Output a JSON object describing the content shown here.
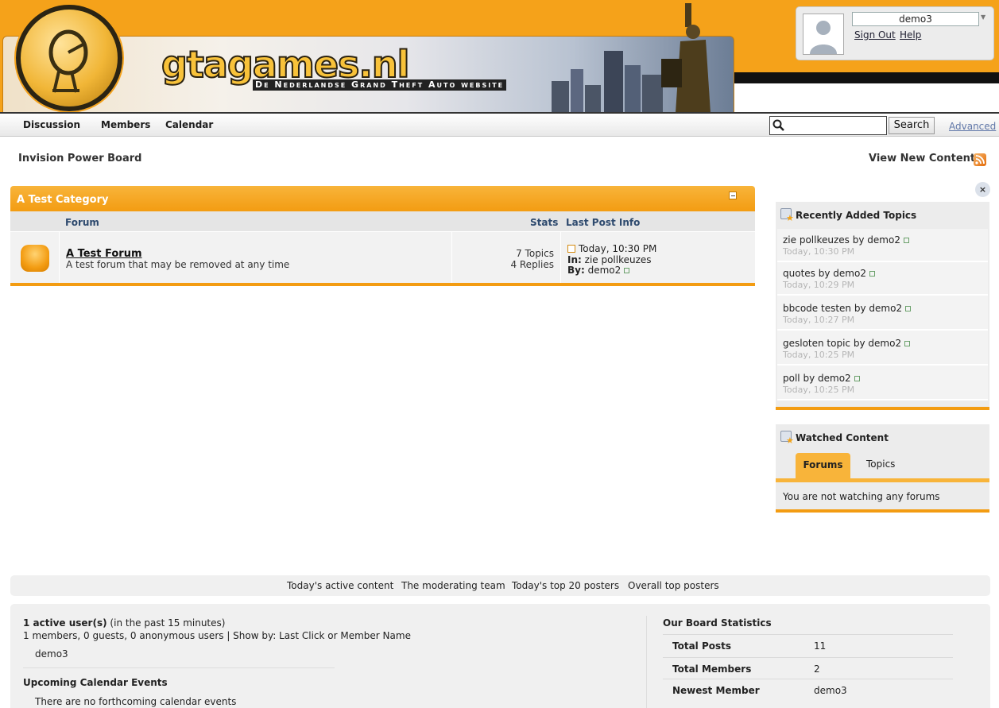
{
  "header": {
    "site_name": "gtagames.nl",
    "tagline": "De Nederlandse Grand Theft Auto website",
    "brand_color": "#f5a21a"
  },
  "user_panel": {
    "username": "demo3",
    "sign_out": "Sign Out",
    "help": "Help"
  },
  "nav": {
    "tabs": [
      "Discussion",
      "Members",
      "Calendar"
    ],
    "search_placeholder": "",
    "search_button": "Search",
    "advanced": "Advanced"
  },
  "breadcrumb": "Invision Power Board",
  "view_new_content": "View New Content",
  "category": {
    "title": "A Test Category",
    "columns": {
      "forum": "Forum",
      "stats": "Stats",
      "last_post": "Last Post Info"
    },
    "forum": {
      "name": "A Test Forum",
      "description": "A test forum that may be removed at any time",
      "topics": "7 Topics",
      "replies": "4 Replies",
      "last_time": "Today, 10:30 PM",
      "in_label": "In:",
      "in_topic": "zie pollkeuzes",
      "by_label": "By:",
      "by_user": "demo2"
    }
  },
  "sidebar": {
    "close": "×",
    "recent_title": "Recently Added Topics",
    "recent": [
      {
        "title": "zie pollkeuzes",
        "by": "by",
        "user": "demo2",
        "time": "Today, 10:30 PM"
      },
      {
        "title": "quotes",
        "by": "by",
        "user": "demo2",
        "time": "Today, 10:29 PM"
      },
      {
        "title": "bbcode testen",
        "by": "by",
        "user": "demo2",
        "time": "Today, 10:27 PM"
      },
      {
        "title": "gesloten topic",
        "by": "by",
        "user": "demo2",
        "time": "Today, 10:25 PM"
      },
      {
        "title": "poll",
        "by": "by",
        "user": "demo2",
        "time": "Today, 10:25 PM"
      }
    ],
    "watched_title": "Watched Content",
    "tab_forums": "Forums",
    "tab_topics": "Topics",
    "watch_empty": "You are not watching any forums"
  },
  "footer_links": [
    "Today's active content",
    "The moderating team",
    "Today's top 20 posters",
    "Overall top posters"
  ],
  "stats": {
    "active_count": "1 active user(s)",
    "active_window": "(in the past 15 minutes)",
    "active_breakdown": "1 members, 0 guests, 0 anonymous users | Show by: Last Click or Member Name",
    "active_user": "demo3",
    "calendar_title": "Upcoming Calendar Events",
    "calendar_empty": "There are no forthcoming calendar events",
    "board_title": "Our Board Statistics",
    "rows": [
      {
        "label": "Total Posts",
        "value": "11"
      },
      {
        "label": "Total Members",
        "value": "2"
      },
      {
        "label": "Newest Member",
        "value": "demo3"
      }
    ]
  }
}
